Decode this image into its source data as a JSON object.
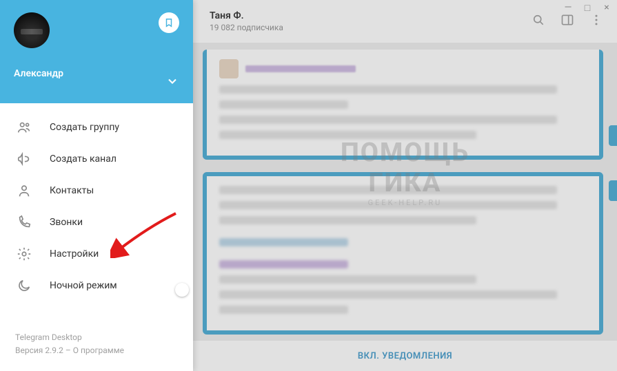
{
  "window": {
    "minimize": "—",
    "maximize": "□",
    "close": "×"
  },
  "profile": {
    "name": "Александр"
  },
  "menu": {
    "create_group": "Создать группу",
    "create_channel": "Создать канал",
    "contacts": "Контакты",
    "calls": "Звонки",
    "settings": "Настройки",
    "night_mode": "Ночной режим"
  },
  "footer": {
    "app_name": "Telegram Desktop",
    "version_prefix": "Версия ",
    "version": "2.9.2",
    "separator": " – ",
    "about": "О программе"
  },
  "chat": {
    "title": "Таня Ф.",
    "subscribers": "19 082 подписчика",
    "footer_action": "ВКЛ. УВЕДОМЛЕНИЯ"
  },
  "watermark": {
    "line1": "ПОМОЩЬ",
    "line2": "ГИКА",
    "url": "GEEK-HELP.RU"
  }
}
